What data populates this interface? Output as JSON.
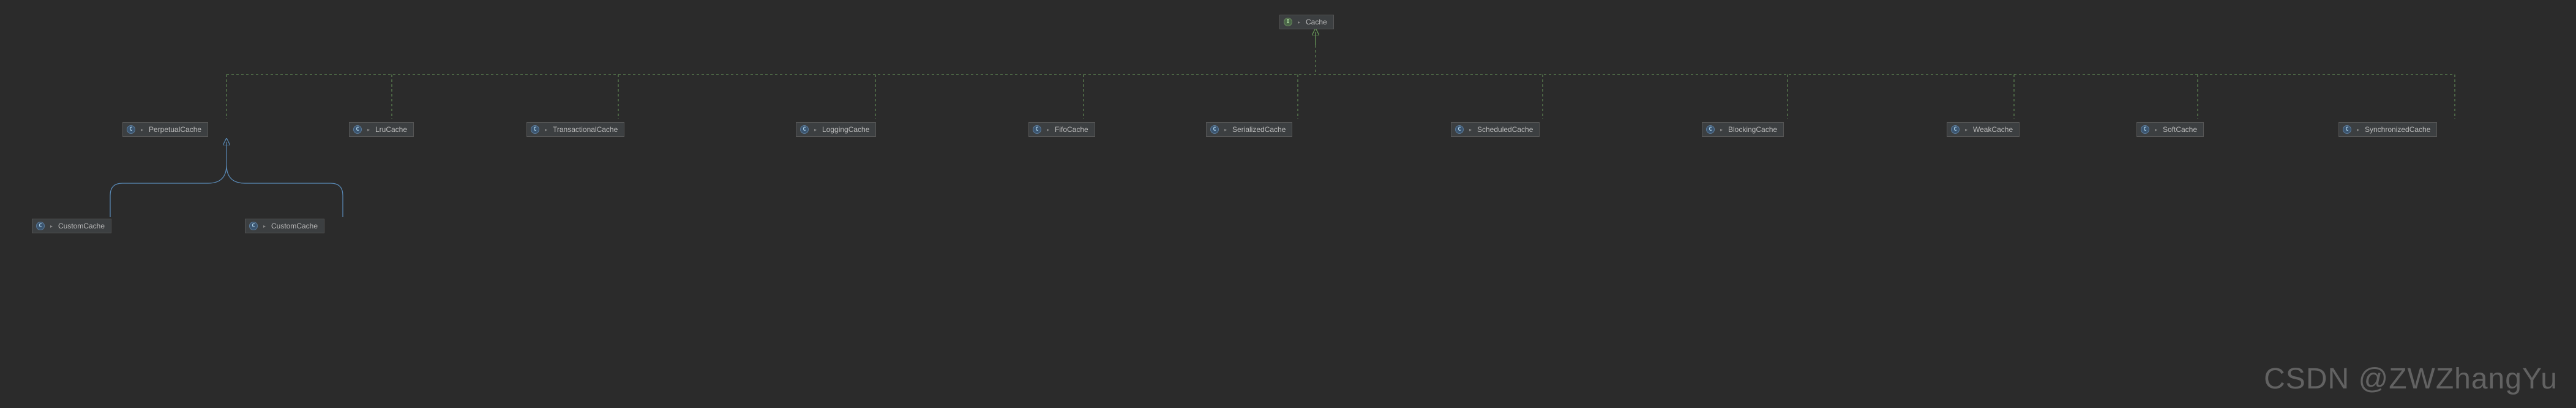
{
  "root": {
    "name": "Cache",
    "type": "interface"
  },
  "level2": [
    {
      "name": "PerpetualCache",
      "type": "class"
    },
    {
      "name": "LruCache",
      "type": "class"
    },
    {
      "name": "TransactionalCache",
      "type": "class"
    },
    {
      "name": "LoggingCache",
      "type": "class"
    },
    {
      "name": "FifoCache",
      "type": "class"
    },
    {
      "name": "SerializedCache",
      "type": "class"
    },
    {
      "name": "ScheduledCache",
      "type": "class"
    },
    {
      "name": "BlockingCache",
      "type": "class"
    },
    {
      "name": "WeakCache",
      "type": "class"
    },
    {
      "name": "SoftCache",
      "type": "class"
    },
    {
      "name": "SynchronizedCache",
      "type": "class"
    }
  ],
  "level3": [
    {
      "name": "CustomCache",
      "type": "class"
    },
    {
      "name": "CustomCache",
      "type": "class"
    }
  ],
  "watermark": "CSDN @ZWZhangYu"
}
